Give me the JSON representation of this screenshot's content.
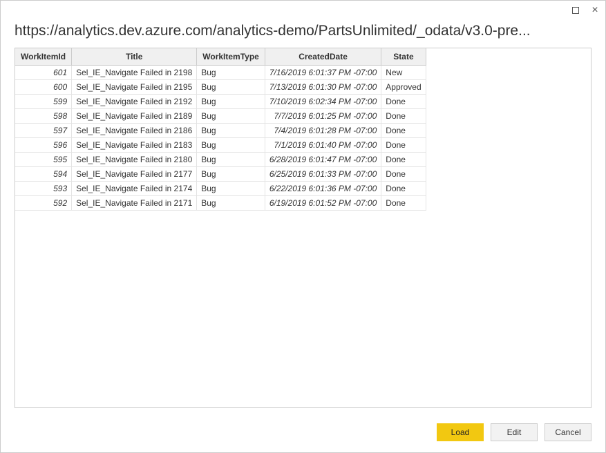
{
  "window": {
    "url_title": "https://analytics.dev.azure.com/analytics-demo/PartsUnlimited/_odata/v3.0-pre..."
  },
  "table": {
    "columns": [
      "WorkItemId",
      "Title",
      "WorkItemType",
      "CreatedDate",
      "State"
    ],
    "rows": [
      {
        "id": "601",
        "title": "Sel_IE_Navigate Failed in 2198",
        "type": "Bug",
        "date": "7/16/2019 6:01:37 PM -07:00",
        "state": "New"
      },
      {
        "id": "600",
        "title": "Sel_IE_Navigate Failed in 2195",
        "type": "Bug",
        "date": "7/13/2019 6:01:30 PM -07:00",
        "state": "Approved"
      },
      {
        "id": "599",
        "title": "Sel_IE_Navigate Failed in 2192",
        "type": "Bug",
        "date": "7/10/2019 6:02:34 PM -07:00",
        "state": "Done"
      },
      {
        "id": "598",
        "title": "Sel_IE_Navigate Failed in 2189",
        "type": "Bug",
        "date": "7/7/2019 6:01:25 PM -07:00",
        "state": "Done"
      },
      {
        "id": "597",
        "title": "Sel_IE_Navigate Failed in 2186",
        "type": "Bug",
        "date": "7/4/2019 6:01:28 PM -07:00",
        "state": "Done"
      },
      {
        "id": "596",
        "title": "Sel_IE_Navigate Failed in 2183",
        "type": "Bug",
        "date": "7/1/2019 6:01:40 PM -07:00",
        "state": "Done"
      },
      {
        "id": "595",
        "title": "Sel_IE_Navigate Failed in 2180",
        "type": "Bug",
        "date": "6/28/2019 6:01:47 PM -07:00",
        "state": "Done"
      },
      {
        "id": "594",
        "title": "Sel_IE_Navigate Failed in 2177",
        "type": "Bug",
        "date": "6/25/2019 6:01:33 PM -07:00",
        "state": "Done"
      },
      {
        "id": "593",
        "title": "Sel_IE_Navigate Failed in 2174",
        "type": "Bug",
        "date": "6/22/2019 6:01:36 PM -07:00",
        "state": "Done"
      },
      {
        "id": "592",
        "title": "Sel_IE_Navigate Failed in 2171",
        "type": "Bug",
        "date": "6/19/2019 6:01:52 PM -07:00",
        "state": "Done"
      }
    ]
  },
  "footer": {
    "load": "Load",
    "edit": "Edit",
    "cancel": "Cancel"
  }
}
